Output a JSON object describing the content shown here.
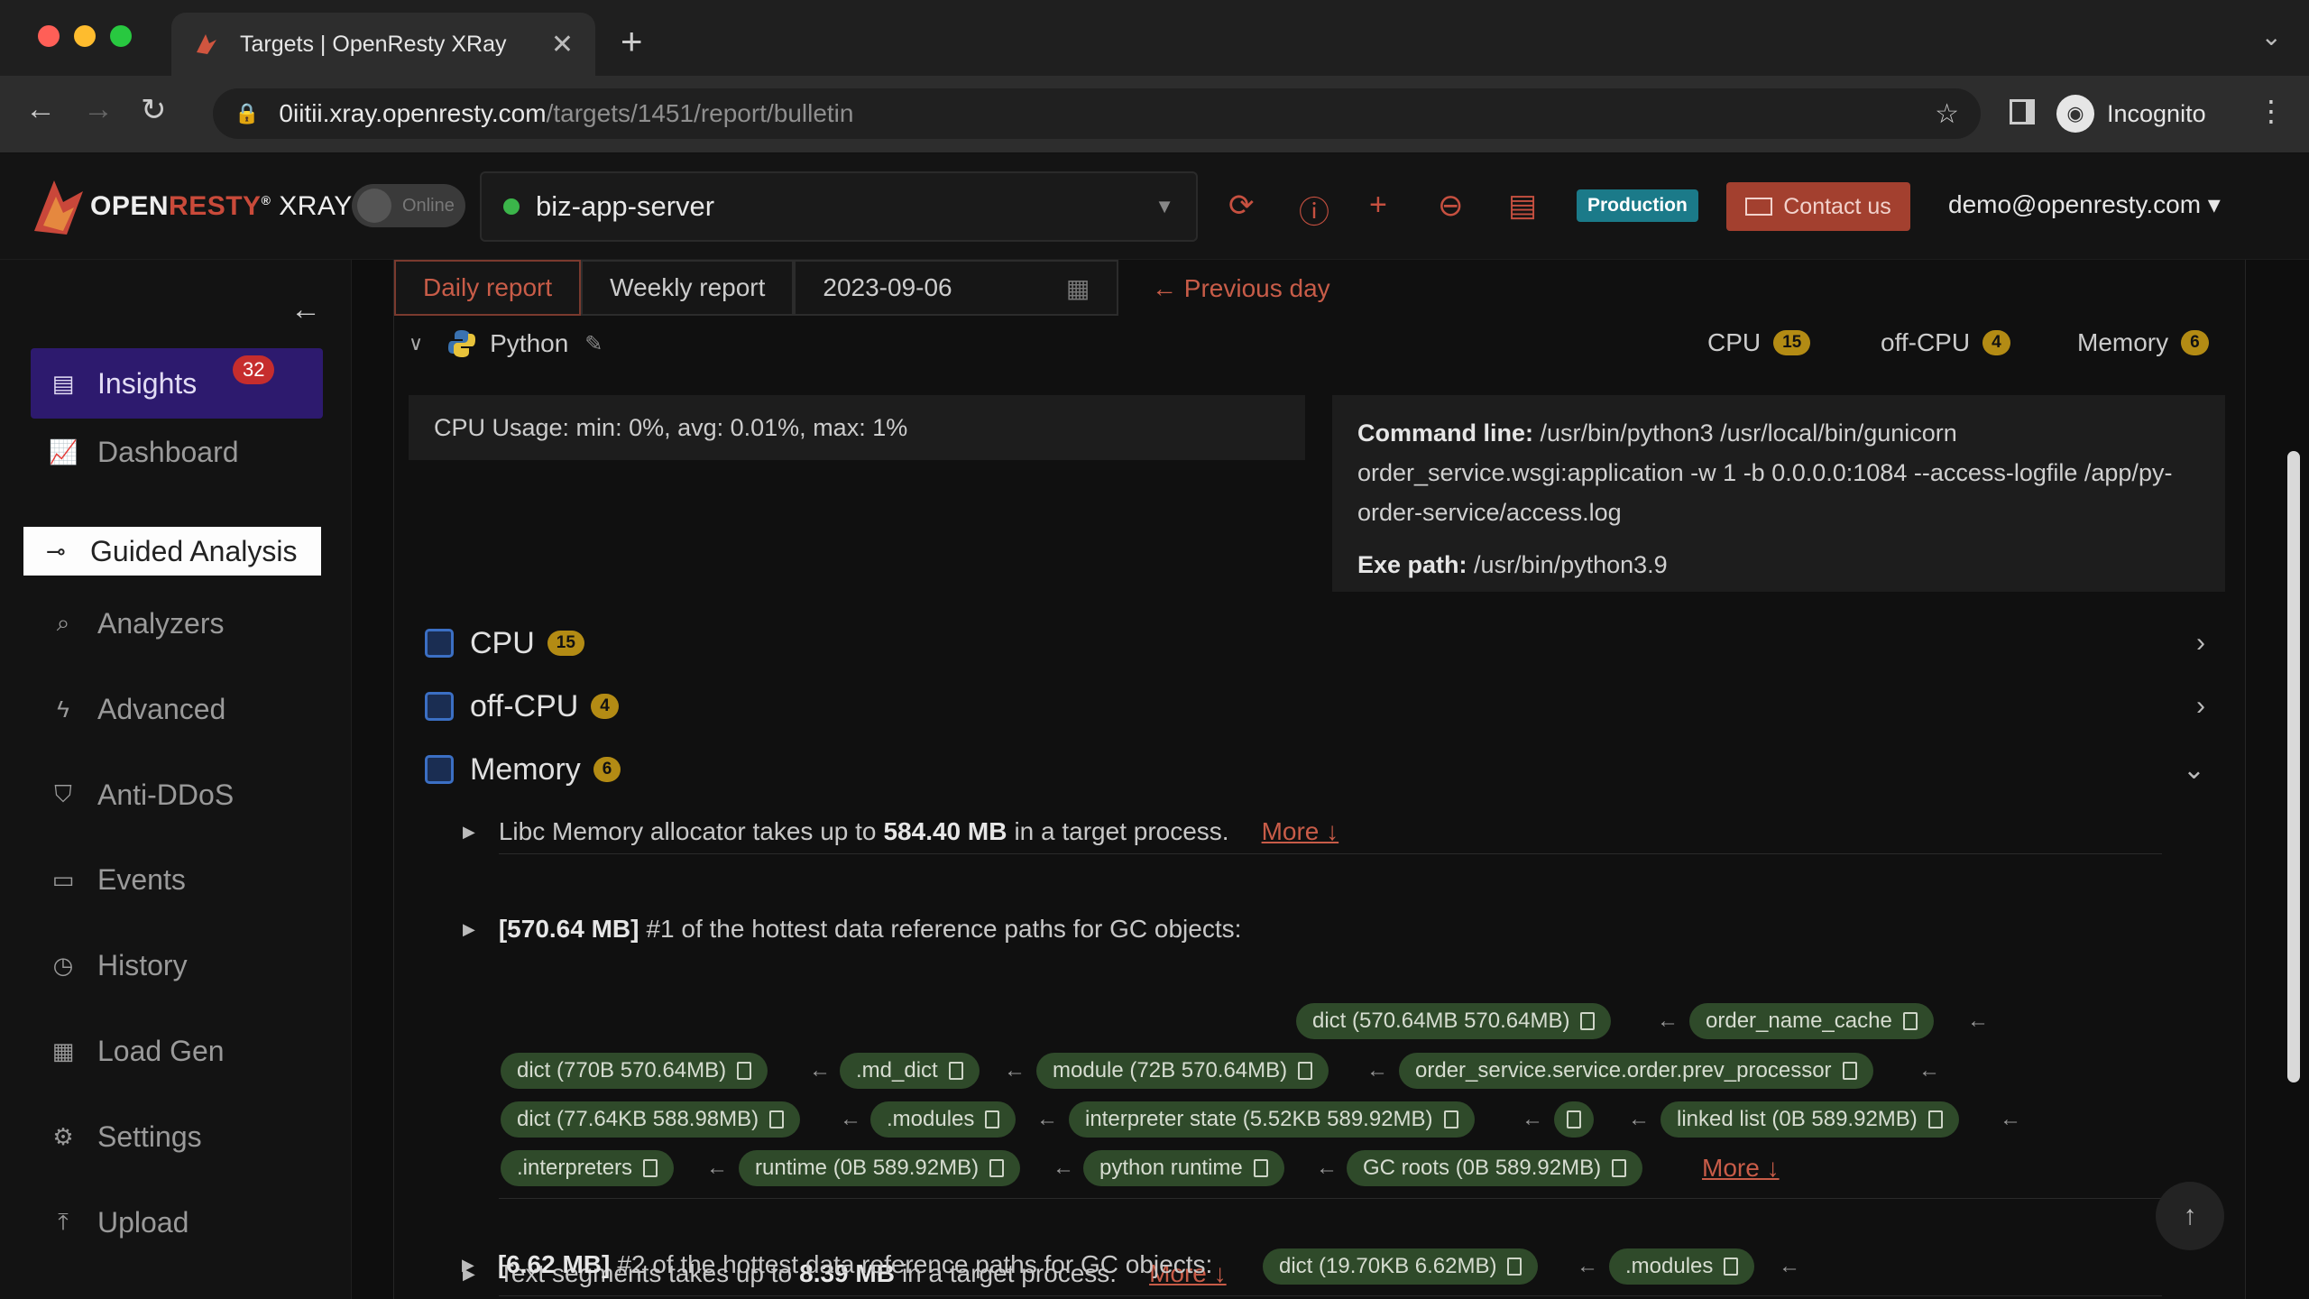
{
  "browser": {
    "tab_title": "Targets | OpenResty XRay",
    "url_host": "0iitii.xray.openresty.com",
    "url_path": "/targets/1451/report/bulletin",
    "profile_label": "Incognito"
  },
  "header": {
    "logo_text_open": "OPEN",
    "logo_text_resty": "RESTY",
    "logo_text_xray": "XRAY",
    "online_label": "Online",
    "target_name": "biz-app-server",
    "env_badge": "Production",
    "contact_label": "Contact us",
    "user_email": "demo@openresty.com"
  },
  "sidebar": {
    "items": [
      {
        "label": "Insights",
        "badge": "32"
      },
      {
        "label": "Dashboard"
      },
      {
        "label": "Guided Analysis"
      },
      {
        "label": "Analyzers"
      },
      {
        "label": "Advanced"
      },
      {
        "label": "Anti-DDoS"
      },
      {
        "label": "Events"
      },
      {
        "label": "History"
      },
      {
        "label": "Load Gen"
      },
      {
        "label": "Settings"
      },
      {
        "label": "Upload"
      }
    ]
  },
  "report": {
    "tab_daily": "Daily report",
    "tab_weekly": "Weekly report",
    "date": "2023-09-06",
    "prev_day": "← Previous day"
  },
  "process": {
    "name": "Python",
    "counts": {
      "cpu_label": "CPU",
      "cpu": "15",
      "offcpu_label": "off-CPU",
      "offcpu": "4",
      "memory_label": "Memory",
      "memory": "6"
    },
    "cpu_usage": "CPU Usage:   min: 0%,  avg: 0.01%,  max: 1%",
    "cmd_label": "Command line:",
    "cmd_value": "/usr/bin/python3 /usr/local/bin/gunicorn order_service.wsgi:application -w 1 -b 0.0.0.0:1084 --access-logfile /app/py-order-service/access.log",
    "exe_label": "Exe path:",
    "exe_value": "/usr/bin/python3.9"
  },
  "sections": {
    "cpu": {
      "label": "CPU",
      "count": "15"
    },
    "offcpu": {
      "label": "off-CPU",
      "count": "4"
    },
    "memory": {
      "label": "Memory",
      "count": "6"
    }
  },
  "memory_items": {
    "libc": {
      "pre": "Libc Memory allocator takes up to",
      "value": "584.40 MB",
      "post": "in a target process.",
      "more": "More ↓"
    },
    "path1": {
      "size": "[570.64 MB]",
      "text": "#1 of the hottest data reference paths for GC objects:",
      "more": "More ↓"
    },
    "text_seg": {
      "pre": "Text segments takes up to",
      "value": "8.39 MB",
      "post": "in a target process.",
      "more": "More ↓"
    },
    "path2": {
      "size": "[6.62 MB]",
      "text": "#2 of the hottest data reference paths for GC objects:"
    }
  },
  "chips1": [
    "dict (570.64MB 570.64MB)",
    "order_name_cache",
    "dict (770B 570.64MB)",
    ".md_dict",
    "module (72B 570.64MB)",
    "order_service.service.order.prev_processor",
    "dict (77.64KB 588.98MB)",
    ".modules",
    "interpreter state (5.52KB 589.92MB)",
    "",
    "linked list (0B 589.92MB)",
    ".interpreters",
    "runtime (0B 589.92MB)",
    "python runtime",
    "GC roots (0B 589.92MB)"
  ],
  "chips2": [
    "dict (19.70KB 6.62MB)",
    ".modules"
  ]
}
